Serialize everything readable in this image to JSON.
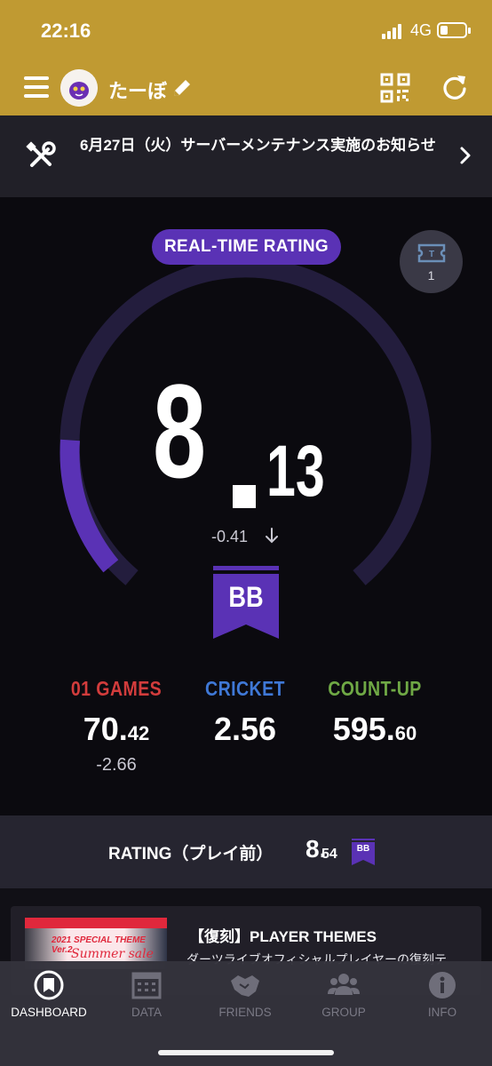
{
  "status_bar": {
    "time": "22:16",
    "network": "4G"
  },
  "header": {
    "username": "たーぼ"
  },
  "notice": {
    "text": "6月27日（火）サーバーメンテナンス実施のお知らせ"
  },
  "rating": {
    "badge_label": "REAL-TIME RATING",
    "ticket_count": "1",
    "value_int": "8",
    "value_dec": "13",
    "delta": "-0.41",
    "class_label": "BB",
    "gauge_fill_fraction": 0.17
  },
  "stats": [
    {
      "label": "01 GAMES",
      "value_int": "70.",
      "value_dec": "42",
      "sub": "-2.66",
      "color": "#d23c3c"
    },
    {
      "label": "CRICKET",
      "value_int": "2.56",
      "value_dec": "",
      "sub": "",
      "color": "#3f78d6"
    },
    {
      "label": "COUNT-UP",
      "value_int": "595.",
      "value_dec": "60",
      "sub": "",
      "color": "#6fa845"
    }
  ],
  "before_play": {
    "label": "RATING（プレイ前）",
    "value_int": "8.",
    "value_dec": "54",
    "class_label": "BB"
  },
  "news": {
    "title": "【復刻】PLAYER THEMES",
    "description": "ダーツライブオフィシャルプレイヤーの復刻テ",
    "thumb_title": "2021 SPECIAL THEME Ver.2",
    "thumb_subtitle": "Summer sale"
  },
  "tabs": [
    {
      "label": "DASHBOARD",
      "active": true
    },
    {
      "label": "DATA",
      "active": false
    },
    {
      "label": "FRIENDS",
      "active": false
    },
    {
      "label": "GROUP",
      "active": false
    },
    {
      "label": "INFO",
      "active": false
    }
  ],
  "colors": {
    "header_gold": "#c09a32",
    "accent_purple": "#5a32b5",
    "gauge_track": "#231d3d"
  }
}
